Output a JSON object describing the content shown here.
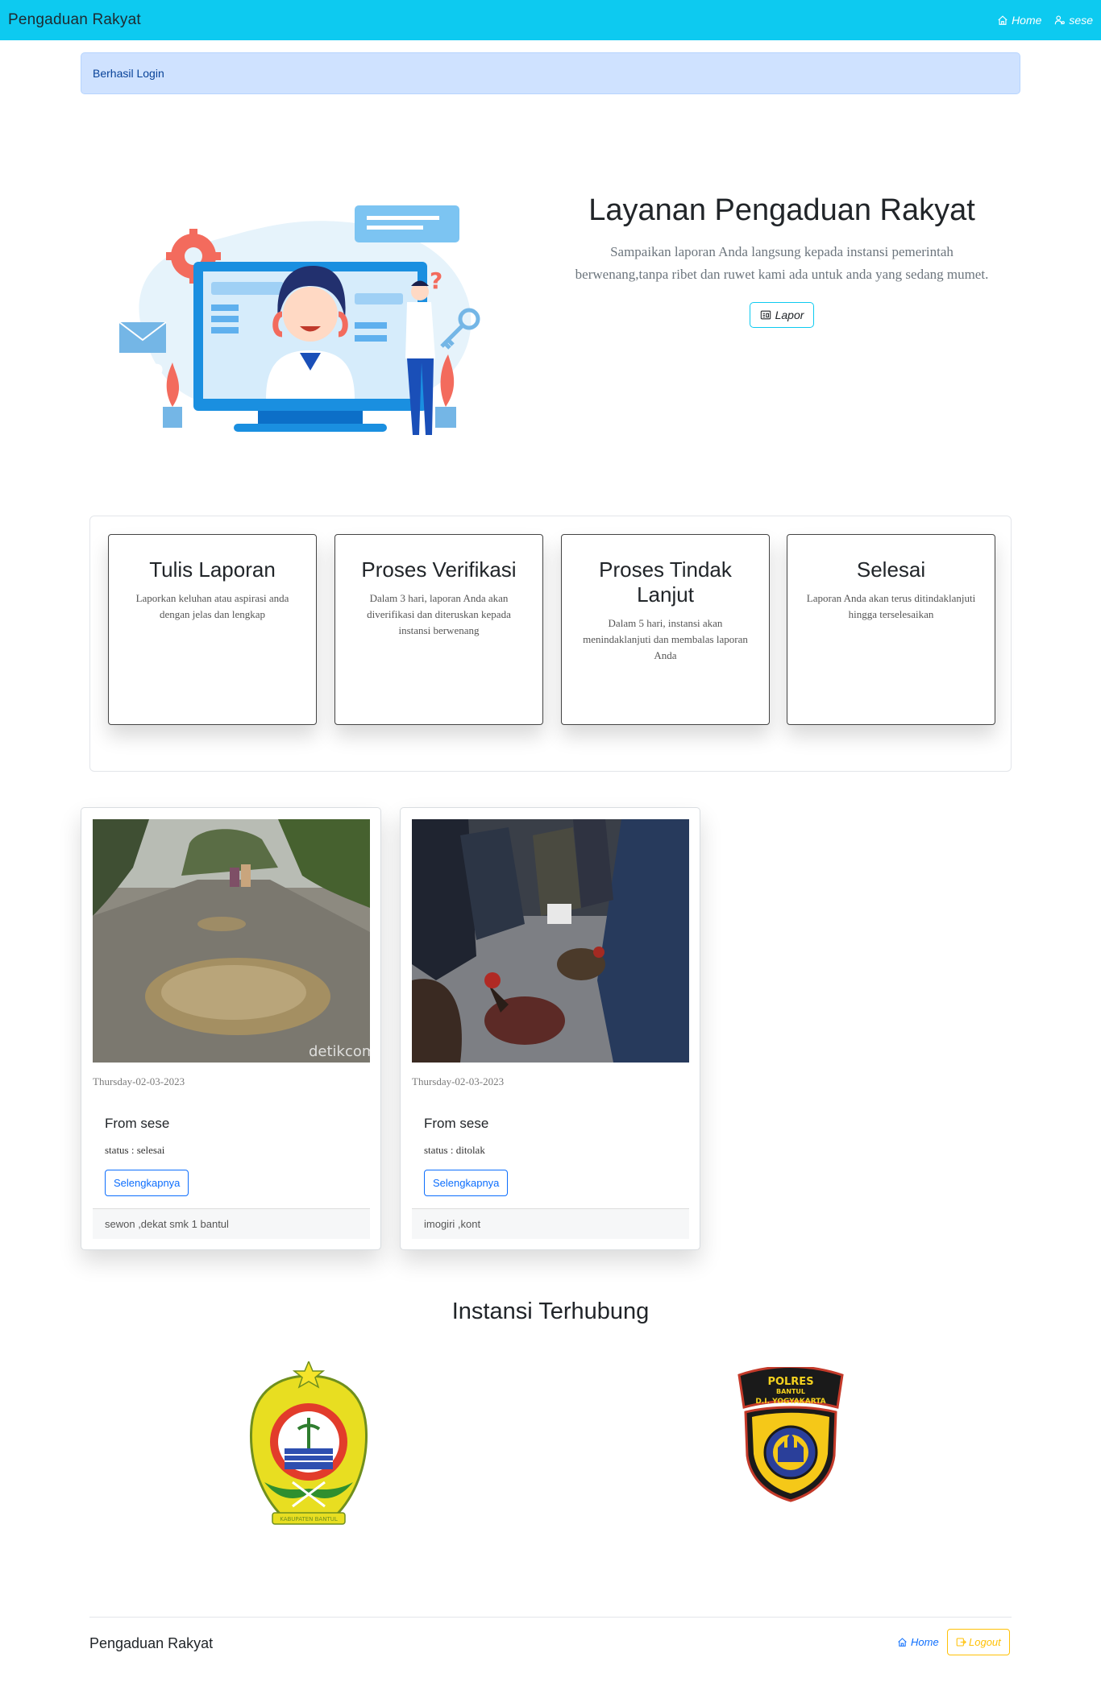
{
  "navbar": {
    "brand": "Pengaduan Rakyat",
    "home_label": "Home",
    "user_label": "sese"
  },
  "alert": {
    "text": "Berhasil Login"
  },
  "hero": {
    "title": "Layanan Pengaduan Rakyat",
    "subtitle_line1": "Sampaikan laporan Anda langsung kepada instansi pemerintah",
    "subtitle_line2": "berwenang,tanpa ribet dan ruwet kami ada untuk anda yang sedang mumet.",
    "button_label": "Lapor"
  },
  "steps": [
    {
      "title": "Tulis Laporan",
      "description": "Laporkan keluhan atau aspirasi anda dengan jelas dan lengkap"
    },
    {
      "title": "Proses Verifikasi",
      "description": "Dalam 3 hari, laporan Anda akan diverifikasi dan diteruskan kepada instansi berwenang"
    },
    {
      "title": "Proses Tindak Lanjut",
      "description": "Dalam 5 hari, instansi akan menindaklanjuti dan membalas laporan Anda"
    },
    {
      "title": "Selesai",
      "description": "Laporan Anda akan terus ditindaklanjuti hingga terselesaikan"
    }
  ],
  "reports": [
    {
      "date": "Thursday-02-03-2023",
      "from": "From sese",
      "status": "status : selesai",
      "button_label": "Selengkapnya",
      "location": "sewon ,dekat smk 1 bantul",
      "watermark": "detikcom"
    },
    {
      "date": "Thursday-02-03-2023",
      "from": "From sese",
      "status": "status : ditolak",
      "button_label": "Selengkapnya",
      "location": "imogiri ,kont"
    }
  ],
  "instansi": {
    "title": "Instansi Terhubung",
    "police_logo_top": "POLRES",
    "police_logo_sub": "BANTUL",
    "police_logo_region": "D.I. YOGYAKARTA",
    "bantul_logo_text": "KABUPATEN BANTUL"
  },
  "footer": {
    "brand": "Pengaduan Rakyat",
    "home_label": "Home",
    "logout_label": "Logout"
  },
  "colors": {
    "navbar": "#0dcaf0",
    "alert_bg": "#cfe2ff",
    "primary": "#0d6efd",
    "warning": "#ffc107"
  }
}
